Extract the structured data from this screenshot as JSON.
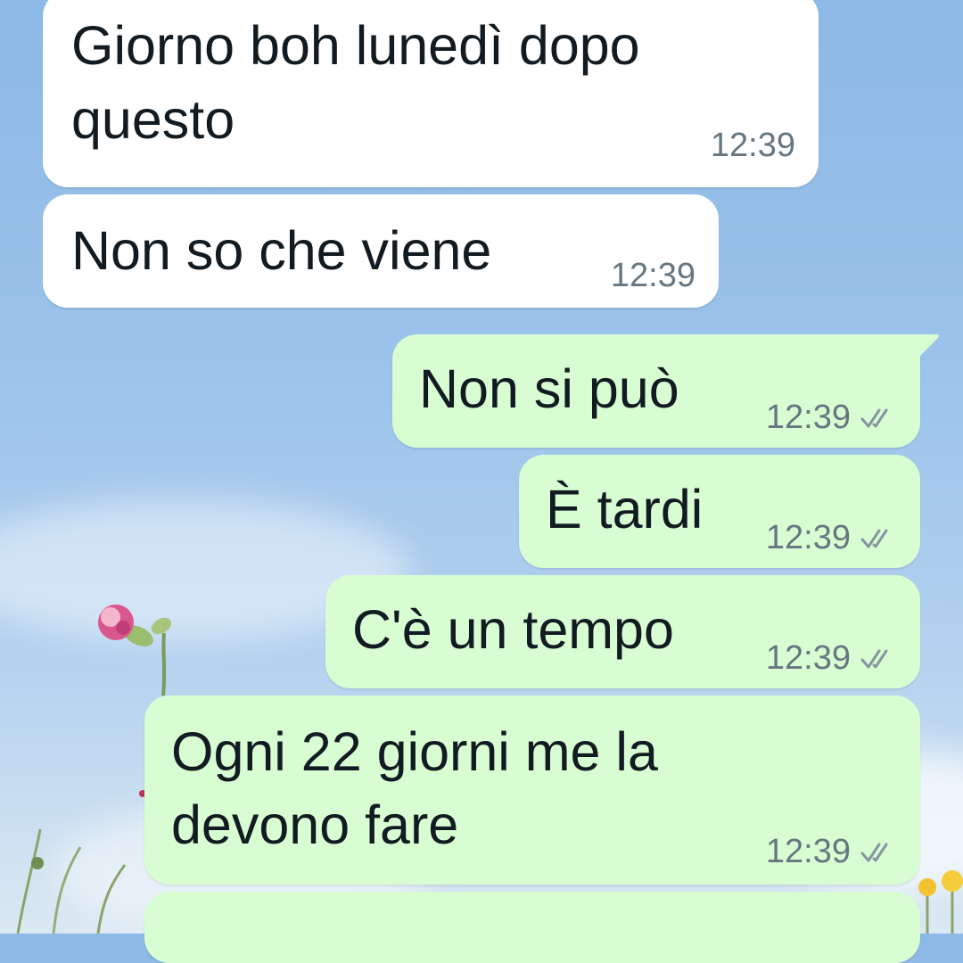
{
  "chat": {
    "messages": [
      {
        "direction": "incoming",
        "lines": [
          "Giorno boh lunedì dopo",
          "questo"
        ],
        "time": "12:39"
      },
      {
        "direction": "incoming",
        "lines": [
          "Non so che viene"
        ],
        "time": "12:39"
      },
      {
        "direction": "outgoing",
        "lines": [
          "Non si può"
        ],
        "time": "12:39",
        "status_icon": "double-check-icon"
      },
      {
        "direction": "outgoing",
        "lines": [
          "È tardi"
        ],
        "time": "12:39",
        "status_icon": "double-check-icon"
      },
      {
        "direction": "outgoing",
        "lines": [
          "C'è un tempo"
        ],
        "time": "12:39",
        "status_icon": "double-check-icon"
      },
      {
        "direction": "outgoing",
        "lines": [
          "Ogni 22 giorni me la",
          "devono fare"
        ],
        "time": "12:39",
        "status_icon": "double-check-icon"
      }
    ]
  },
  "colors": {
    "incoming_bubble": "#ffffff",
    "outgoing_bubble": "#d9fdd3",
    "meta_text": "#667781",
    "wallpaper_sky": "#8cb9e6"
  }
}
